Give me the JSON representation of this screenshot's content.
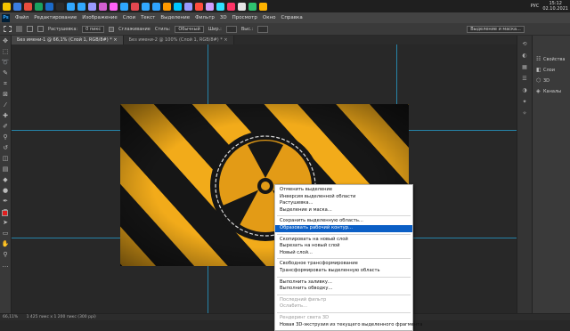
{
  "taskbar": {
    "icon_colors": [
      "#f5c400",
      "#3b7de0",
      "#e84c3d",
      "#1aa260",
      "#1b6ac9",
      "#2c2c2c",
      "#31a8ff",
      "#31a8ff",
      "#9999ff",
      "#d45fd1",
      "#ff61f6",
      "#2ea7ff",
      "#e34850",
      "#31a8ff",
      "#2fa4ff",
      "#ff9a00",
      "#00c8ff",
      "#9999ff",
      "#ff4d3d",
      "#cf9fff",
      "#2fe0ff",
      "#ff3366",
      "#e5e5e5",
      "#2fc26f",
      "#ffb400"
    ],
    "language": "РУС",
    "time": "15:12",
    "date": "02.10.2021"
  },
  "menubar": {
    "logo": "Ps",
    "items": [
      "Файл",
      "Редактирование",
      "Изображение",
      "Слои",
      "Текст",
      "Выделение",
      "Фильтр",
      "3D",
      "Просмотр",
      "Окно",
      "Справка"
    ]
  },
  "optbar": {
    "feather_value": "0 пикс",
    "antialias_label": "Сглаживание",
    "style_label": "Стиль:",
    "style_value": "Обычный",
    "width_label": "Шир.:",
    "height_label": "Выс.:",
    "select_mask_button": "Выделение и маска..."
  },
  "tabs": [
    {
      "label": "Без имени-1 @ 66,1% (Слой 1, RGB/8#) *",
      "active": true
    },
    {
      "label": "Без имени-2 @ 100% (Слой 1, RGB/8#) *",
      "active": false
    }
  ],
  "panels": {
    "items": [
      {
        "icon": "properties-icon",
        "label": "Свойства"
      },
      {
        "icon": "layers-icon",
        "label": "Слои"
      },
      {
        "icon": "3d-icon",
        "label": "3D"
      },
      {
        "icon": "channels-icon",
        "label": "Каналы"
      }
    ]
  },
  "status": {
    "zoom": "66,11%",
    "doc_info": "1 425 пикс x 1 200 пикс (300 ppi)"
  },
  "artwork": {
    "stripe_color": "#f2ab1a",
    "dark_color": "#161616"
  },
  "context_menu": {
    "groups": [
      [
        {
          "label": "Отменить выделение",
          "enabled": true
        },
        {
          "label": "Инверсия выделенной области",
          "enabled": true
        },
        {
          "label": "Растушевка...",
          "enabled": true
        },
        {
          "label": "Выделение и маска...",
          "enabled": true
        }
      ],
      [
        {
          "label": "Сохранить выделенную область...",
          "enabled": true
        },
        {
          "label": "Образовать рабочий контур...",
          "enabled": true,
          "highlighted": true
        }
      ],
      [
        {
          "label": "Скопировать на новый слой",
          "enabled": true
        },
        {
          "label": "Вырезать на новый слой",
          "enabled": true
        },
        {
          "label": "Новый слой...",
          "enabled": true
        }
      ],
      [
        {
          "label": "Свободное трансформирование",
          "enabled": true
        },
        {
          "label": "Трансформировать выделенную область",
          "enabled": true
        }
      ],
      [
        {
          "label": "Выполнить заливку...",
          "enabled": true
        },
        {
          "label": "Выполнить обводку...",
          "enabled": true
        }
      ],
      [
        {
          "label": "Последний фильтр",
          "enabled": false
        },
        {
          "label": "Ослабить...",
          "enabled": false
        }
      ],
      [
        {
          "label": "Рендеринг света 3D",
          "enabled": false
        },
        {
          "label": "Новая 3D-экструзия из текущего выделенного фрагмента",
          "enabled": true
        }
      ]
    ]
  }
}
